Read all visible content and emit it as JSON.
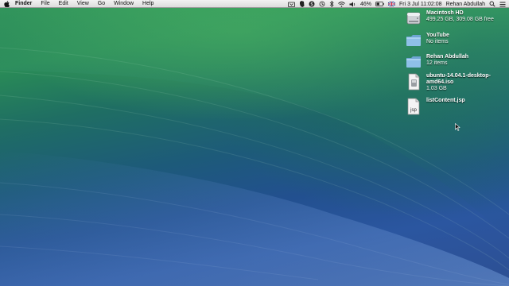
{
  "menubar": {
    "app_name": "Finder",
    "menus": [
      "File",
      "Edit",
      "View",
      "Go",
      "Window",
      "Help"
    ],
    "battery": "46%",
    "datetime": "Fri 3 Jul  11:02:08",
    "user": "Rehan Abdullah",
    "tray_icons": [
      "dropbox-icon",
      "evernote-icon",
      "skype-icon",
      "sync-icon",
      "bluetooth-icon",
      "wifi-icon",
      "volume-icon",
      "battery-icon",
      "flag-icon",
      "search-icon",
      "list-icon"
    ]
  },
  "desktop": {
    "items": [
      {
        "name": "Macintosh HD",
        "info": "499.25 GB, 309.08 GB free",
        "icon": "hard-drive-icon"
      },
      {
        "name": "YouTube",
        "info": "No items",
        "icon": "folder-icon"
      },
      {
        "name": "Rehan Abdullah",
        "info": "12 items",
        "icon": "folder-icon"
      },
      {
        "name": "ubuntu-14.04.1-desktop-amd64.iso",
        "name_line1": "ubuntu-14.04.1-desktop-",
        "name_line2": "amd64.iso",
        "info": "1.03 GB",
        "icon": "disk-image-icon"
      },
      {
        "name": "listContent.jsp",
        "info": "",
        "icon": "jsp-file-icon",
        "badge": "jsp"
      }
    ]
  },
  "colors": {
    "menubar_bg": "#e8e8e8",
    "folder_blue": "#7fb3dc",
    "wave_green": "#2a8d56",
    "wave_blue": "#2b56a0"
  }
}
